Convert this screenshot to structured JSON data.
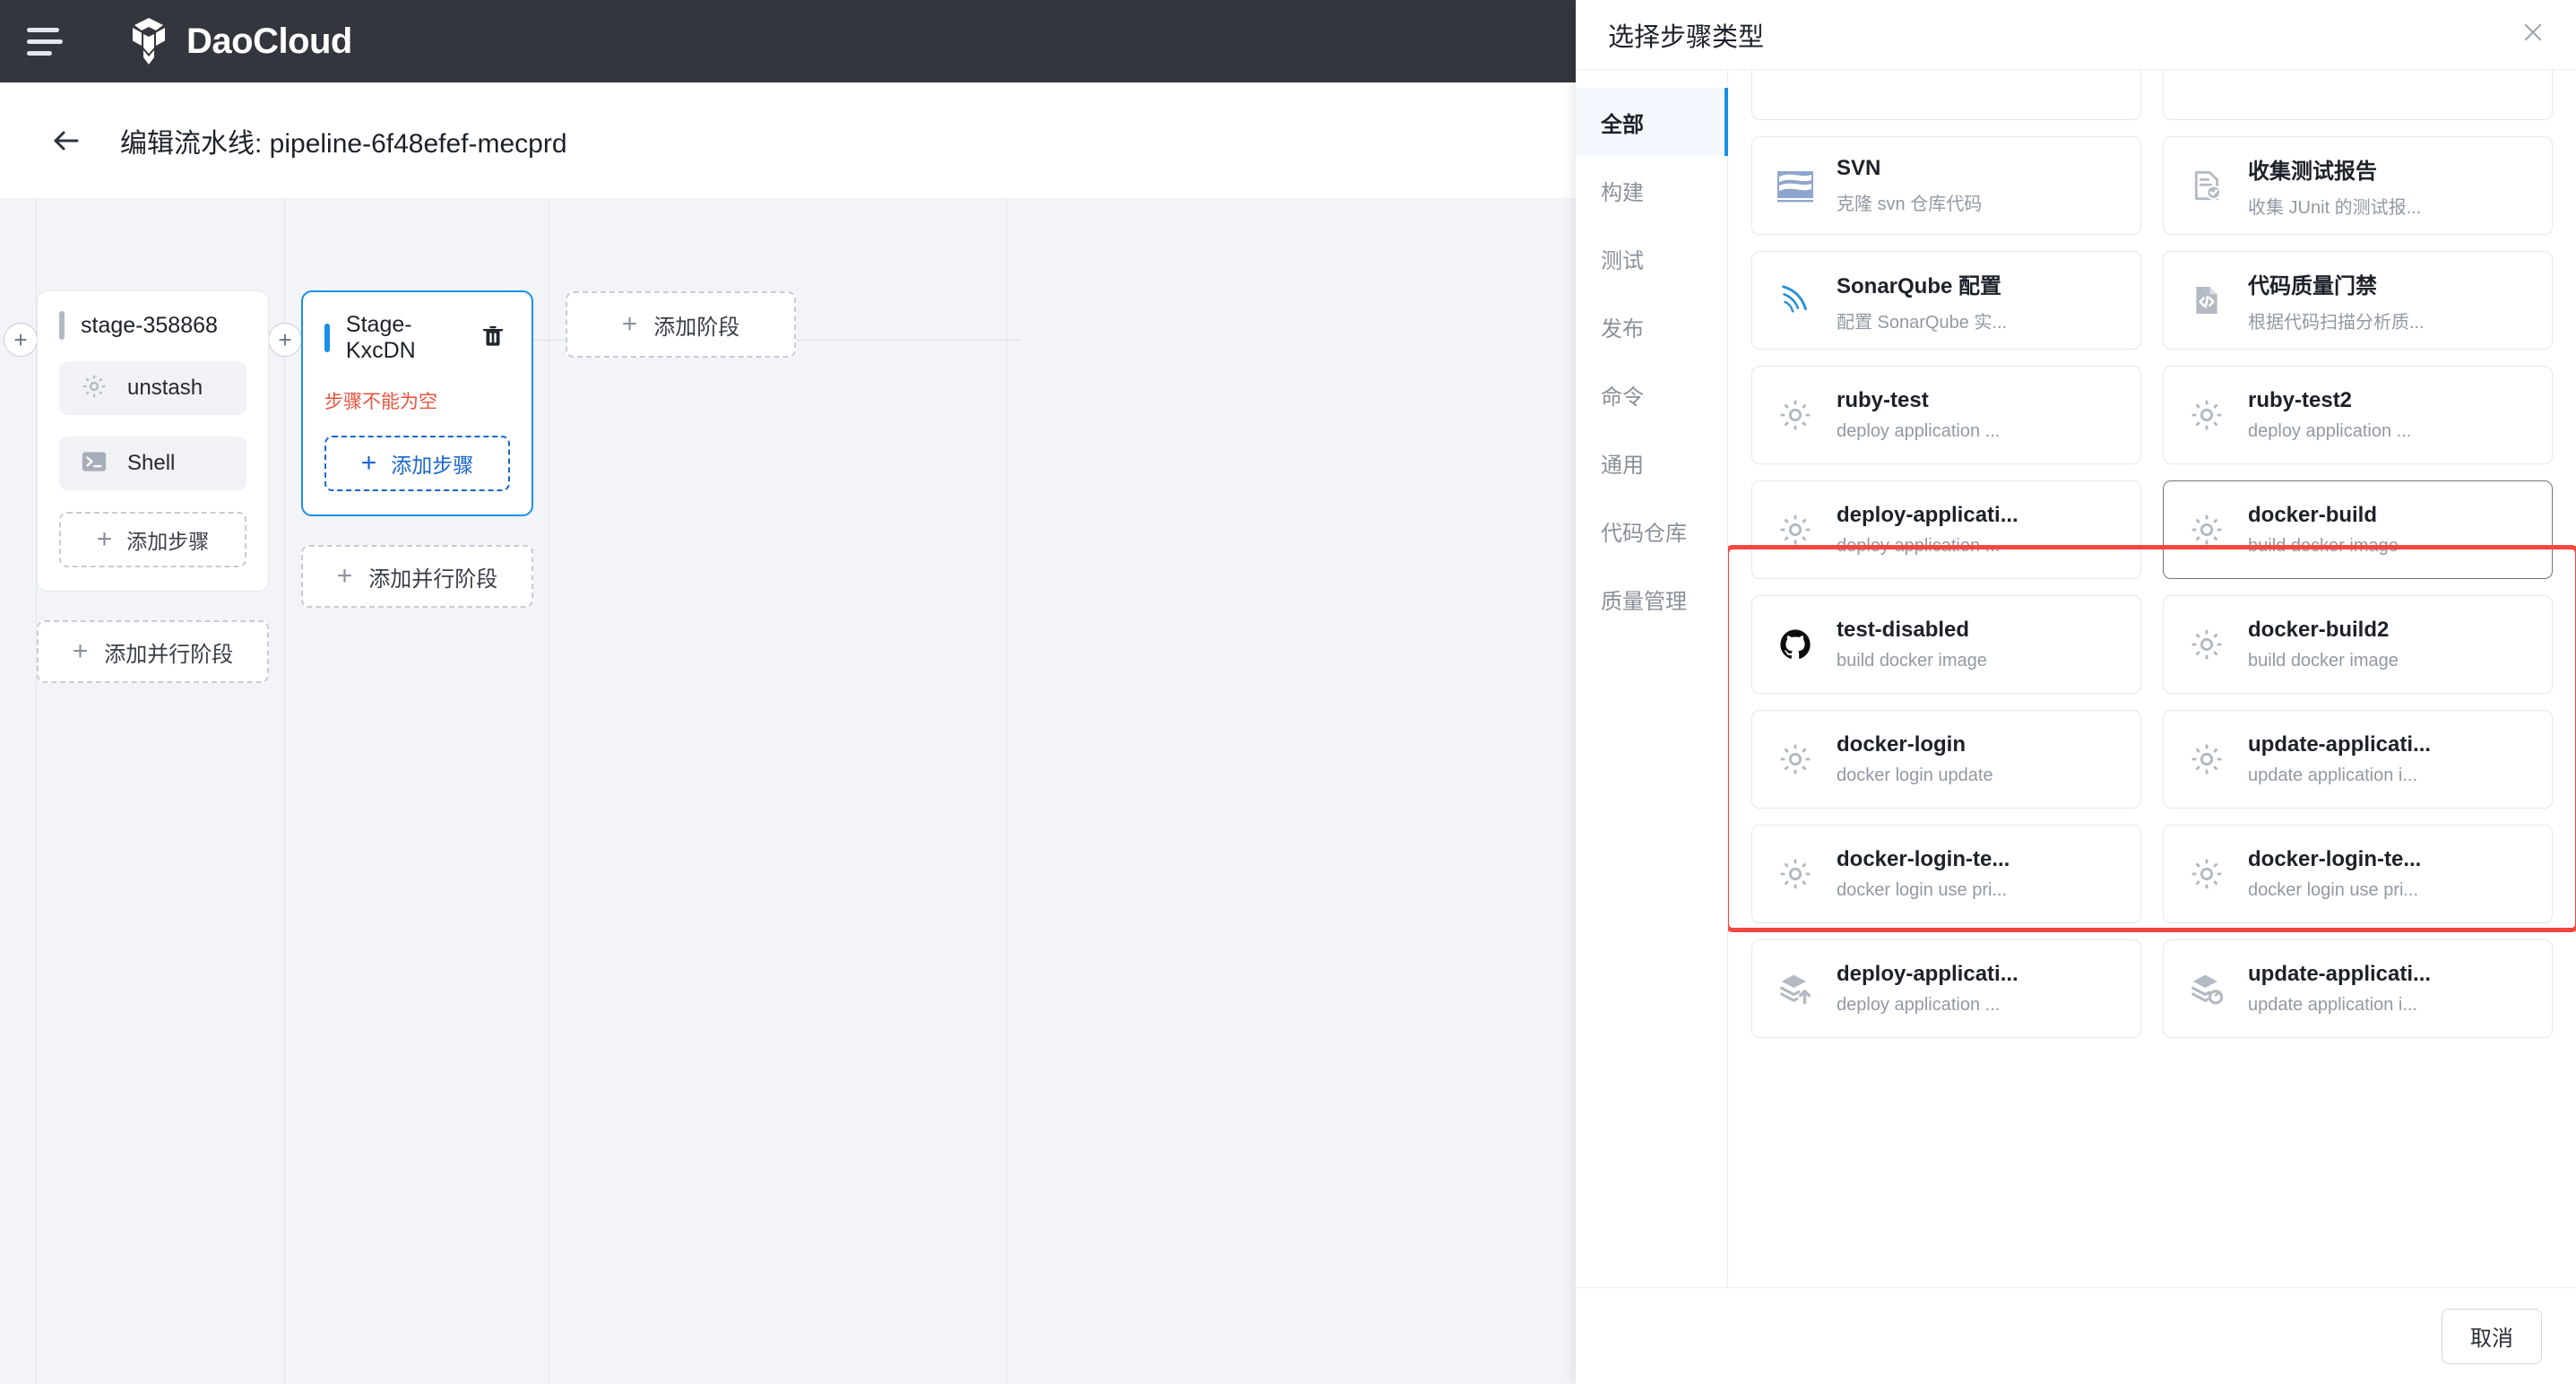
{
  "topnav": {
    "menu_icon": "hamburger-icon",
    "brand_icon": "daocloud-cube-logo",
    "brand_name": "DaoCloud"
  },
  "page_header": {
    "back_icon": "arrow-left-icon",
    "title": "编辑流水线: pipeline-6f48efef-mecprd"
  },
  "canvas": {
    "add_stage_label": "添加阶段",
    "add_step_label": "添加步骤",
    "add_parallel_stage_label": "添加并行阶段",
    "plus_glyph": "+",
    "stages": [
      {
        "name": "stage-358868",
        "selected": false,
        "error": "",
        "steps": [
          {
            "label": "unstash",
            "icon": "gear-icon"
          },
          {
            "label": "Shell",
            "icon": "terminal-icon"
          }
        ]
      },
      {
        "name": "Stage-KxcDN",
        "selected": true,
        "error": "步骤不能为空",
        "delete_icon": "trash-icon",
        "steps": []
      }
    ]
  },
  "drawer": {
    "title": "选择步骤类型",
    "close_icon": "close-icon",
    "cancel_label": "取消",
    "categories": [
      {
        "label": "全部",
        "active": true
      },
      {
        "label": "构建",
        "active": false
      },
      {
        "label": "测试",
        "active": false
      },
      {
        "label": "发布",
        "active": false
      },
      {
        "label": "命令",
        "active": false
      },
      {
        "label": "通用",
        "active": false
      },
      {
        "label": "代码仓库",
        "active": false
      },
      {
        "label": "质量管理",
        "active": false
      }
    ],
    "step_types": [
      {
        "title": "",
        "desc": "",
        "icon": "cut-off-card",
        "clipped": true
      },
      {
        "title": "",
        "desc": "",
        "icon": "cut-off-card",
        "clipped": true
      },
      {
        "title": "SVN",
        "desc": "克隆 svn 仓库代码",
        "icon": "svn-icon"
      },
      {
        "title": "收集测试报告",
        "desc": "收集 JUnit 的测试报...",
        "icon": "test-report-icon"
      },
      {
        "title": "SonarQube 配置",
        "desc": "配置 SonarQube 实...",
        "icon": "sonarqube-icon"
      },
      {
        "title": "代码质量门禁",
        "desc": "根据代码扫描分析质...",
        "icon": "code-quality-icon"
      },
      {
        "title": "ruby-test",
        "desc": "deploy application ...",
        "icon": "gear-icon"
      },
      {
        "title": "ruby-test2",
        "desc": "deploy application ...",
        "icon": "gear-icon"
      },
      {
        "title": "deploy-applicati...",
        "desc": "deploy application ...",
        "icon": "gear-icon"
      },
      {
        "title": "docker-build",
        "desc": "build docker image",
        "icon": "gear-icon",
        "hovered": true
      },
      {
        "title": "test-disabled",
        "desc": "build docker image",
        "icon": "github-icon"
      },
      {
        "title": "docker-build2",
        "desc": "build docker image",
        "icon": "gear-icon"
      },
      {
        "title": "docker-login",
        "desc": "docker login update",
        "icon": "gear-icon"
      },
      {
        "title": "update-applicati...",
        "desc": "update application i...",
        "icon": "gear-icon"
      },
      {
        "title": "docker-login-te...",
        "desc": "docker login use pri...",
        "icon": "gear-icon"
      },
      {
        "title": "docker-login-te...",
        "desc": "docker login use pri...",
        "icon": "gear-icon"
      },
      {
        "title": "deploy-applicati...",
        "desc": "deploy application ...",
        "icon": "layers-up-icon"
      },
      {
        "title": "update-applicati...",
        "desc": "update application i...",
        "icon": "layers-sync-icon"
      }
    ]
  },
  "colors": {
    "nav_bg": "#33363d",
    "canvas_bg": "#f2f4f8",
    "accent_blue": "#1890e8",
    "error_red": "#e6553f",
    "highlight_red": "#f4473f",
    "link_blue": "#1765cf"
  }
}
